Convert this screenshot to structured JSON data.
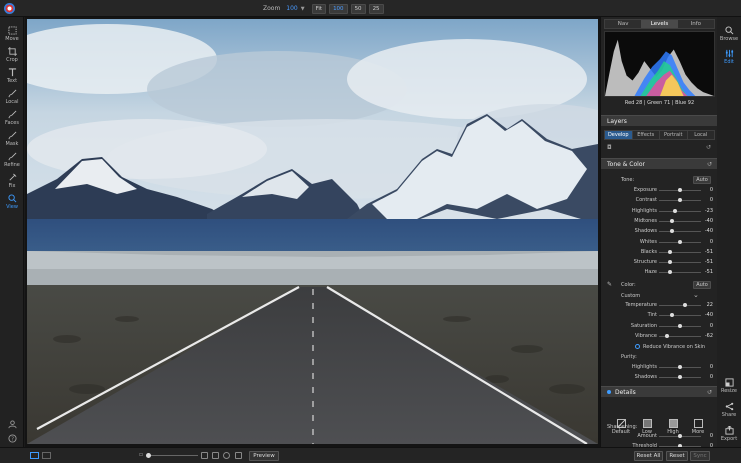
{
  "topbar": {
    "zoom_label": "Zoom",
    "zoom_value": "100",
    "zoom_buttons": [
      "Fit",
      "100",
      "50",
      "25"
    ],
    "active_zoom": "100"
  },
  "tools": [
    {
      "label": "Move",
      "icon": "move-icon"
    },
    {
      "label": "Crop",
      "icon": "crop-icon"
    },
    {
      "label": "Text",
      "icon": "text-icon"
    },
    {
      "label": "Local",
      "icon": "brush-icon"
    },
    {
      "label": "Faces",
      "icon": "face-icon"
    },
    {
      "label": "Mask",
      "icon": "mask-icon"
    },
    {
      "label": "Refine",
      "icon": "refine-icon"
    },
    {
      "label": "Fix",
      "icon": "fix-icon"
    },
    {
      "label": "View",
      "icon": "view-icon",
      "active": true
    }
  ],
  "right_rail": {
    "browse": "Browse",
    "edit": "Edit",
    "resize": "Resize",
    "share": "Share",
    "export": "Export"
  },
  "panel": {
    "nav_tabs": [
      "Nav",
      "Levels",
      "Info"
    ],
    "active_nav_tab": "Levels",
    "rgb_readout": "Red  28  |  Green  71  |  Blue  92",
    "layers_title": "Layers",
    "sub_tabs": [
      "Develop",
      "Effects",
      "Portrait",
      "Local"
    ],
    "active_sub_tab": "Develop",
    "tone_color_title": "Tone & Color",
    "tone_label": "Tone:",
    "auto_label": "Auto",
    "tone_sliders": [
      {
        "label": "Exposure",
        "value": "0",
        "pos": 0.5
      },
      {
        "label": "Contrast",
        "value": "0",
        "pos": 0.5
      },
      {
        "label": "Highlights",
        "value": "-23",
        "pos": 0.38
      },
      {
        "label": "Midtones",
        "value": "-40",
        "pos": 0.3
      },
      {
        "label": "Shadows",
        "value": "-40",
        "pos": 0.3
      },
      {
        "label": "Whites",
        "value": "0",
        "pos": 0.5
      },
      {
        "label": "Blacks",
        "value": "-51",
        "pos": 0.25
      },
      {
        "label": "Structure",
        "value": "-51",
        "pos": 0.25
      },
      {
        "label": "Haze",
        "value": "-51",
        "pos": 0.25
      }
    ],
    "color_label": "Color:",
    "color_auto": "Auto",
    "color_preset": "Custom",
    "color_sliders": [
      {
        "label": "Temperature",
        "value": "22",
        "pos": 0.61
      },
      {
        "label": "Tint",
        "value": "-40",
        "pos": 0.3
      },
      {
        "label": "Saturation",
        "value": "0",
        "pos": 0.5
      },
      {
        "label": "Vibrance",
        "value": "-62",
        "pos": 0.19
      }
    ],
    "reduce_vibrance": "Reduce Vibrance on Skin",
    "purity_label": "Purity:",
    "purity_sliders": [
      {
        "label": "Highlights",
        "value": "0",
        "pos": 0.5
      },
      {
        "label": "Shadows",
        "value": "0",
        "pos": 0.5
      }
    ],
    "details_title": "Details",
    "detail_presets": [
      "Default",
      "Low",
      "High",
      "More"
    ],
    "sharpening_label": "Sharpening:",
    "sharpening_sliders": [
      {
        "label": "Amount",
        "value": "0",
        "pos": 0.5
      },
      {
        "label": "Threshold",
        "value": "0",
        "pos": 0.5
      }
    ]
  },
  "bottombar": {
    "preview_label": "Preview",
    "reset_all": "Reset All",
    "reset": "Reset",
    "sync": "Sync"
  },
  "colors": {
    "accent": "#3e9cff",
    "panel_bg": "#232323",
    "active_tab": "#2b5b8f"
  }
}
